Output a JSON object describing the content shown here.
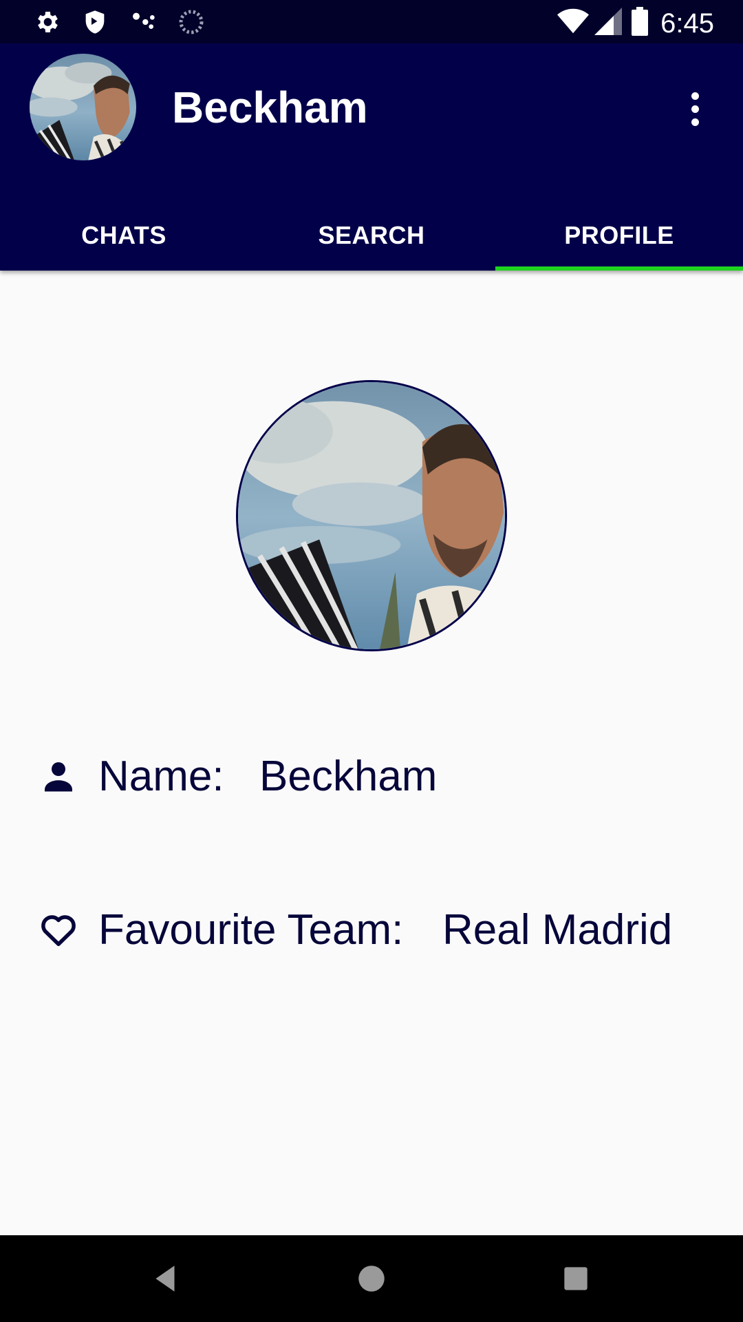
{
  "status_bar": {
    "time": "6:45",
    "icons_left": [
      "settings-icon",
      "shield-icon",
      "assistant-icon",
      "loading-icon"
    ],
    "icons_right": [
      "wifi-icon",
      "signal-icon",
      "battery-icon"
    ]
  },
  "app_bar": {
    "title": "Beckham",
    "tabs": [
      {
        "label": "CHATS",
        "selected": false
      },
      {
        "label": "SEARCH",
        "selected": false
      },
      {
        "label": "PROFILE",
        "selected": true
      }
    ],
    "indicator_color": "#1fd41f",
    "background_color": "#03004a"
  },
  "profile": {
    "name_label": "Name:",
    "name_value": "Beckham",
    "team_label": "Favourite Team:",
    "team_value": "Real Madrid"
  },
  "nav_bar": {
    "buttons": [
      "back-icon",
      "home-icon",
      "recents-icon"
    ]
  }
}
